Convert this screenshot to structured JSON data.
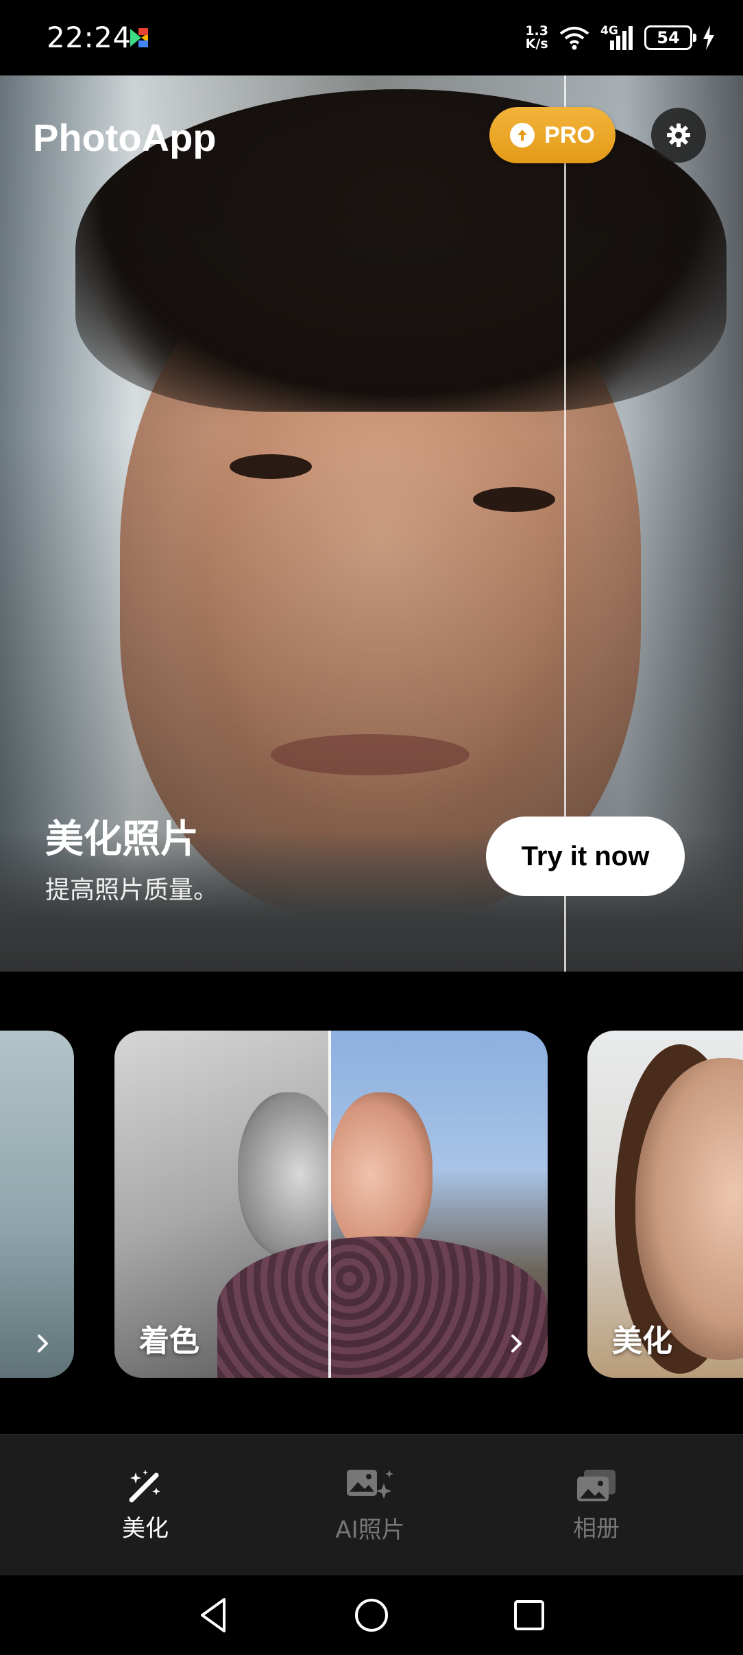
{
  "status_bar": {
    "time": "22:24",
    "net_speed_top": "1.3",
    "net_speed_bottom": "K/s",
    "network_type": "4G",
    "battery": "54"
  },
  "header": {
    "app_title": "PhotoApp",
    "pro_label": "PRO"
  },
  "hero": {
    "heading": "美化照片",
    "subtext": "提高照片质量。",
    "cta_label": "Try it now"
  },
  "carousel": {
    "cards": [
      {
        "label": ""
      },
      {
        "label": "着色"
      },
      {
        "label": "美化"
      }
    ]
  },
  "bottom_nav": {
    "items": [
      {
        "label": "美化",
        "icon": "magic-wand-icon",
        "active": true
      },
      {
        "label": "AI照片",
        "icon": "ai-photo-icon",
        "active": false
      },
      {
        "label": "相册",
        "icon": "album-icon",
        "active": false
      }
    ]
  },
  "colors": {
    "pro_gradient_top": "#f3b43b",
    "pro_gradient_bottom": "#e39a17",
    "nav_background": "#1c1c1c",
    "inactive_text": "#777777"
  }
}
